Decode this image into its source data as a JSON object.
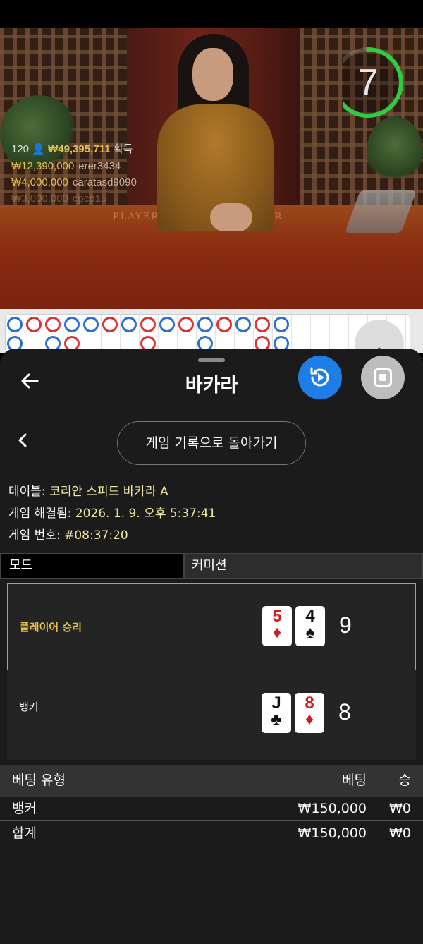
{
  "timer": {
    "seconds": "7",
    "progress": 0.7,
    "color": "#2ecc40"
  },
  "winners": {
    "count": "120",
    "total": "₩49,395,711",
    "suffix": "획득",
    "rows": [
      {
        "amount": "₩12,390,000",
        "name": "erer3434"
      },
      {
        "amount": "₩4,000,000",
        "name": "caratasd9090"
      },
      {
        "amount": "₩3,000,000",
        "name": "cpcp15"
      }
    ]
  },
  "felt": {
    "player": "PLAYER",
    "banker": "BANKER"
  },
  "sheet": {
    "title": "바카라",
    "history_button": "게임 기록으로 돌아가기",
    "table_label": "테이블:",
    "table_value": "코리안 스피드 바카라 A",
    "resolved_label": "게임 해결됨:",
    "resolved_value": "2026. 1. 9. 오후 5:37:41",
    "round_label": "게임 번호:",
    "round_value": "#08:37:20",
    "mode_label": "모드",
    "mode_value": "커미션"
  },
  "result": {
    "player": {
      "label": "플레이어 승리",
      "score": "9",
      "cards": [
        {
          "rank": "5",
          "suit": "♦",
          "color": "red"
        },
        {
          "rank": "4",
          "suit": "♠",
          "color": "black"
        }
      ]
    },
    "banker": {
      "label": "뱅커",
      "score": "8",
      "cards": [
        {
          "rank": "J",
          "suit": "♣",
          "color": "black"
        },
        {
          "rank": "8",
          "suit": "♦",
          "color": "red"
        }
      ]
    }
  },
  "bets": {
    "headers": {
      "type": "베팅 유형",
      "bet": "베팅",
      "win": "승"
    },
    "rows": [
      {
        "type": "뱅커",
        "bet": "₩150,000",
        "win": "₩0"
      },
      {
        "type": "합계",
        "bet": "₩150,000",
        "win": "₩0"
      }
    ]
  },
  "colors": {
    "accent_blue": "#1e7ee8",
    "win_gold": "#e5c14a",
    "banker_red": "#d33333",
    "player_blue": "#2a6fd6"
  }
}
